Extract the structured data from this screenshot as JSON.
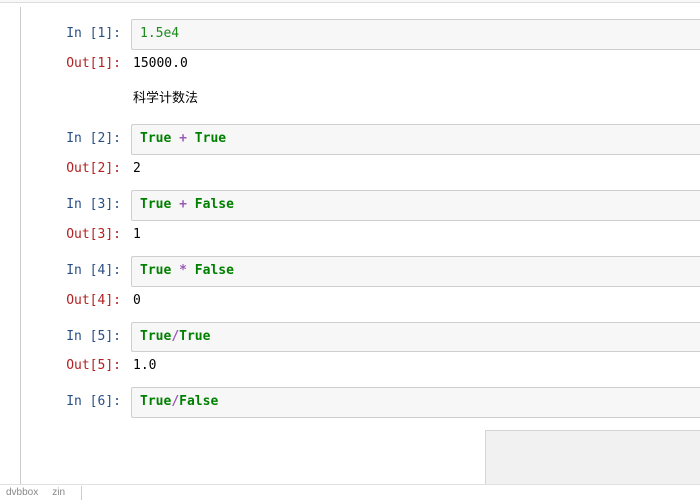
{
  "cells": [
    {
      "in_n": "1",
      "code_parts": [
        {
          "t": "1.5e4",
          "c": "tok-num"
        }
      ],
      "out_n": "1",
      "out": "15000.0",
      "md": "科学计数法"
    },
    {
      "in_n": "2",
      "code_parts": [
        {
          "t": "True",
          "c": "tok-kw"
        },
        {
          "t": " ",
          "c": ""
        },
        {
          "t": "+",
          "c": "tok-op"
        },
        {
          "t": " ",
          "c": ""
        },
        {
          "t": "True",
          "c": "tok-kw"
        }
      ],
      "out_n": "2",
      "out": "2"
    },
    {
      "in_n": "3",
      "code_parts": [
        {
          "t": "True",
          "c": "tok-kw"
        },
        {
          "t": " ",
          "c": ""
        },
        {
          "t": "+",
          "c": "tok-op"
        },
        {
          "t": " ",
          "c": ""
        },
        {
          "t": "False",
          "c": "tok-kw"
        }
      ],
      "out_n": "3",
      "out": "1"
    },
    {
      "in_n": "4",
      "code_parts": [
        {
          "t": "True",
          "c": "tok-kw"
        },
        {
          "t": " ",
          "c": ""
        },
        {
          "t": "*",
          "c": "tok-op"
        },
        {
          "t": " ",
          "c": ""
        },
        {
          "t": "False",
          "c": "tok-kw"
        }
      ],
      "out_n": "4",
      "out": "0"
    },
    {
      "in_n": "5",
      "code_parts": [
        {
          "t": "True",
          "c": "tok-kw"
        },
        {
          "t": "/",
          "c": "tok-op"
        },
        {
          "t": "True",
          "c": "tok-kw"
        }
      ],
      "out_n": "5",
      "out": "1.0"
    },
    {
      "in_n": "6",
      "code_parts": [
        {
          "t": "True",
          "c": "tok-kw"
        },
        {
          "t": "/",
          "c": "tok-op"
        },
        {
          "t": "False",
          "c": "tok-kw"
        }
      ]
    }
  ],
  "labels": {
    "in": "In ",
    "out": "Out"
  },
  "status": {
    "s1": "dvbbox",
    "s2": "zin"
  }
}
